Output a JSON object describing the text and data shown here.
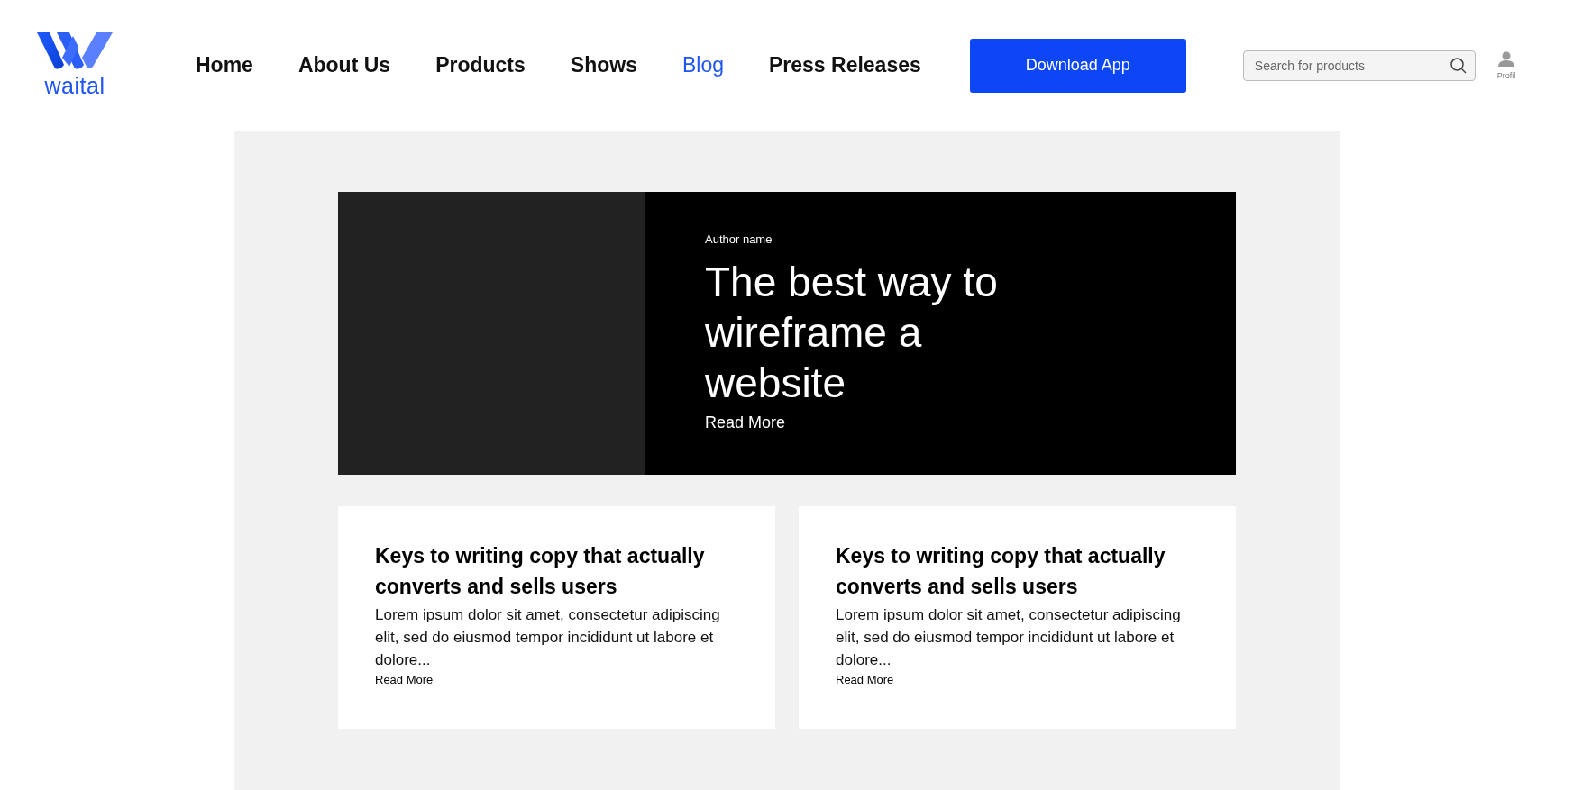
{
  "logo": {
    "text": "waital"
  },
  "nav": [
    {
      "label": "Home",
      "selected": false
    },
    {
      "label": "About Us",
      "selected": false
    },
    {
      "label": "Products",
      "selected": false
    },
    {
      "label": "Shows",
      "selected": false
    },
    {
      "label": "Blog",
      "selected": true
    },
    {
      "label": "Press Releases",
      "selected": false
    }
  ],
  "download_button": "Download App",
  "search": {
    "placeholder": "Search for products"
  },
  "profile": {
    "label": "Profil"
  },
  "hero": {
    "author": "Author name",
    "title": "The best way to wireframe a website",
    "link": "Read More"
  },
  "cards": [
    {
      "title": "Keys to writing copy that actually converts and sells users",
      "body": "Lorem ipsum dolor sit amet, consectetur adipiscing elit, sed do eiusmod tempor incididunt ut labore et dolore...",
      "link": "Read More"
    },
    {
      "title": "Keys to writing copy that actually converts and sells users",
      "body": "Lorem ipsum dolor sit amet, consectetur adipiscing elit, sed do eiusmod tempor incididunt ut labore et dolore...",
      "link": "Read More"
    }
  ]
}
